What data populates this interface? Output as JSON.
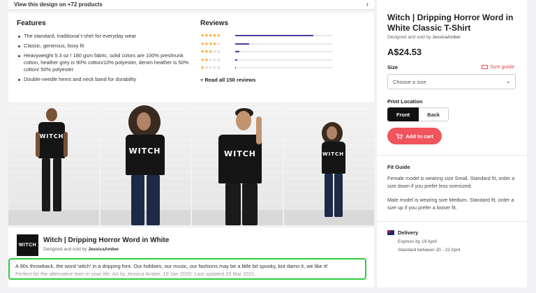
{
  "top_strip": {
    "text": "View this design on +72 products"
  },
  "features": {
    "heading": "Features",
    "items": [
      "The standard, traditional t-shirt for everyday wear",
      "Classic, generous, boxy fit",
      "Heavyweight 5.3 oz / 180 gsm fabric, solid colors are 100% preshrunk cotton, heather grey is 90% cotton/10% polyester, denim heather is 50% cotton/ 50% polyester",
      "Double-needle hems and neck band for durability"
    ]
  },
  "reviews": {
    "heading": "Reviews",
    "rows": [
      {
        "stars": 5,
        "share": 0.8
      },
      {
        "stars": 4,
        "share": 0.14
      },
      {
        "stars": 3,
        "share": 0.04
      },
      {
        "stars": 2,
        "share": 0.02
      },
      {
        "stars": 1,
        "share": 0.01
      }
    ],
    "read_all": "+ Read all 150 reviews"
  },
  "photos": {
    "shirt_text": "WITCH"
  },
  "summary": {
    "thumb_text": "WITCH",
    "title": "Witch | Dripping Horror Word in White",
    "by_prefix": "Designed and sold by",
    "by_name": "JessicaAmber",
    "desc_line1": "A 90s throwback, the word 'witch' in a dripping font. Our hobbies, our music, our fashions may be a little bit spooky, but damn it, we like it!",
    "desc_line2": "Perfect for the alternative teen in your life. Art by Jessica Amber, 19 Jan 2020. Last updated 20 Mar 2021."
  },
  "product": {
    "title": "Witch | Dripping Horror Word in White Classic T-Shirt",
    "by_prefix": "Designed and sold by",
    "by_name": "JessicaAmber",
    "price": "A$24.53",
    "size_label": "Size",
    "size_guide": "Size guide",
    "size_placeholder": "Choose a size",
    "print_label": "Print Location",
    "print_front": "Front",
    "print_back": "Back",
    "add_to_cart": "Add to cart",
    "accent_color": "#f0545c"
  },
  "fit_guide": {
    "heading": "Fit Guide",
    "female": "Female model is wearing size Small. Standard fit, order a size down if you prefer less oversized.",
    "male": "Male model is wearing size Medium. Standard fit, order a size up if you prefer a looser fit."
  },
  "delivery": {
    "heading": "Delivery",
    "express": "Express by 19 April",
    "standard": "Standard between 20 - 22 April"
  }
}
